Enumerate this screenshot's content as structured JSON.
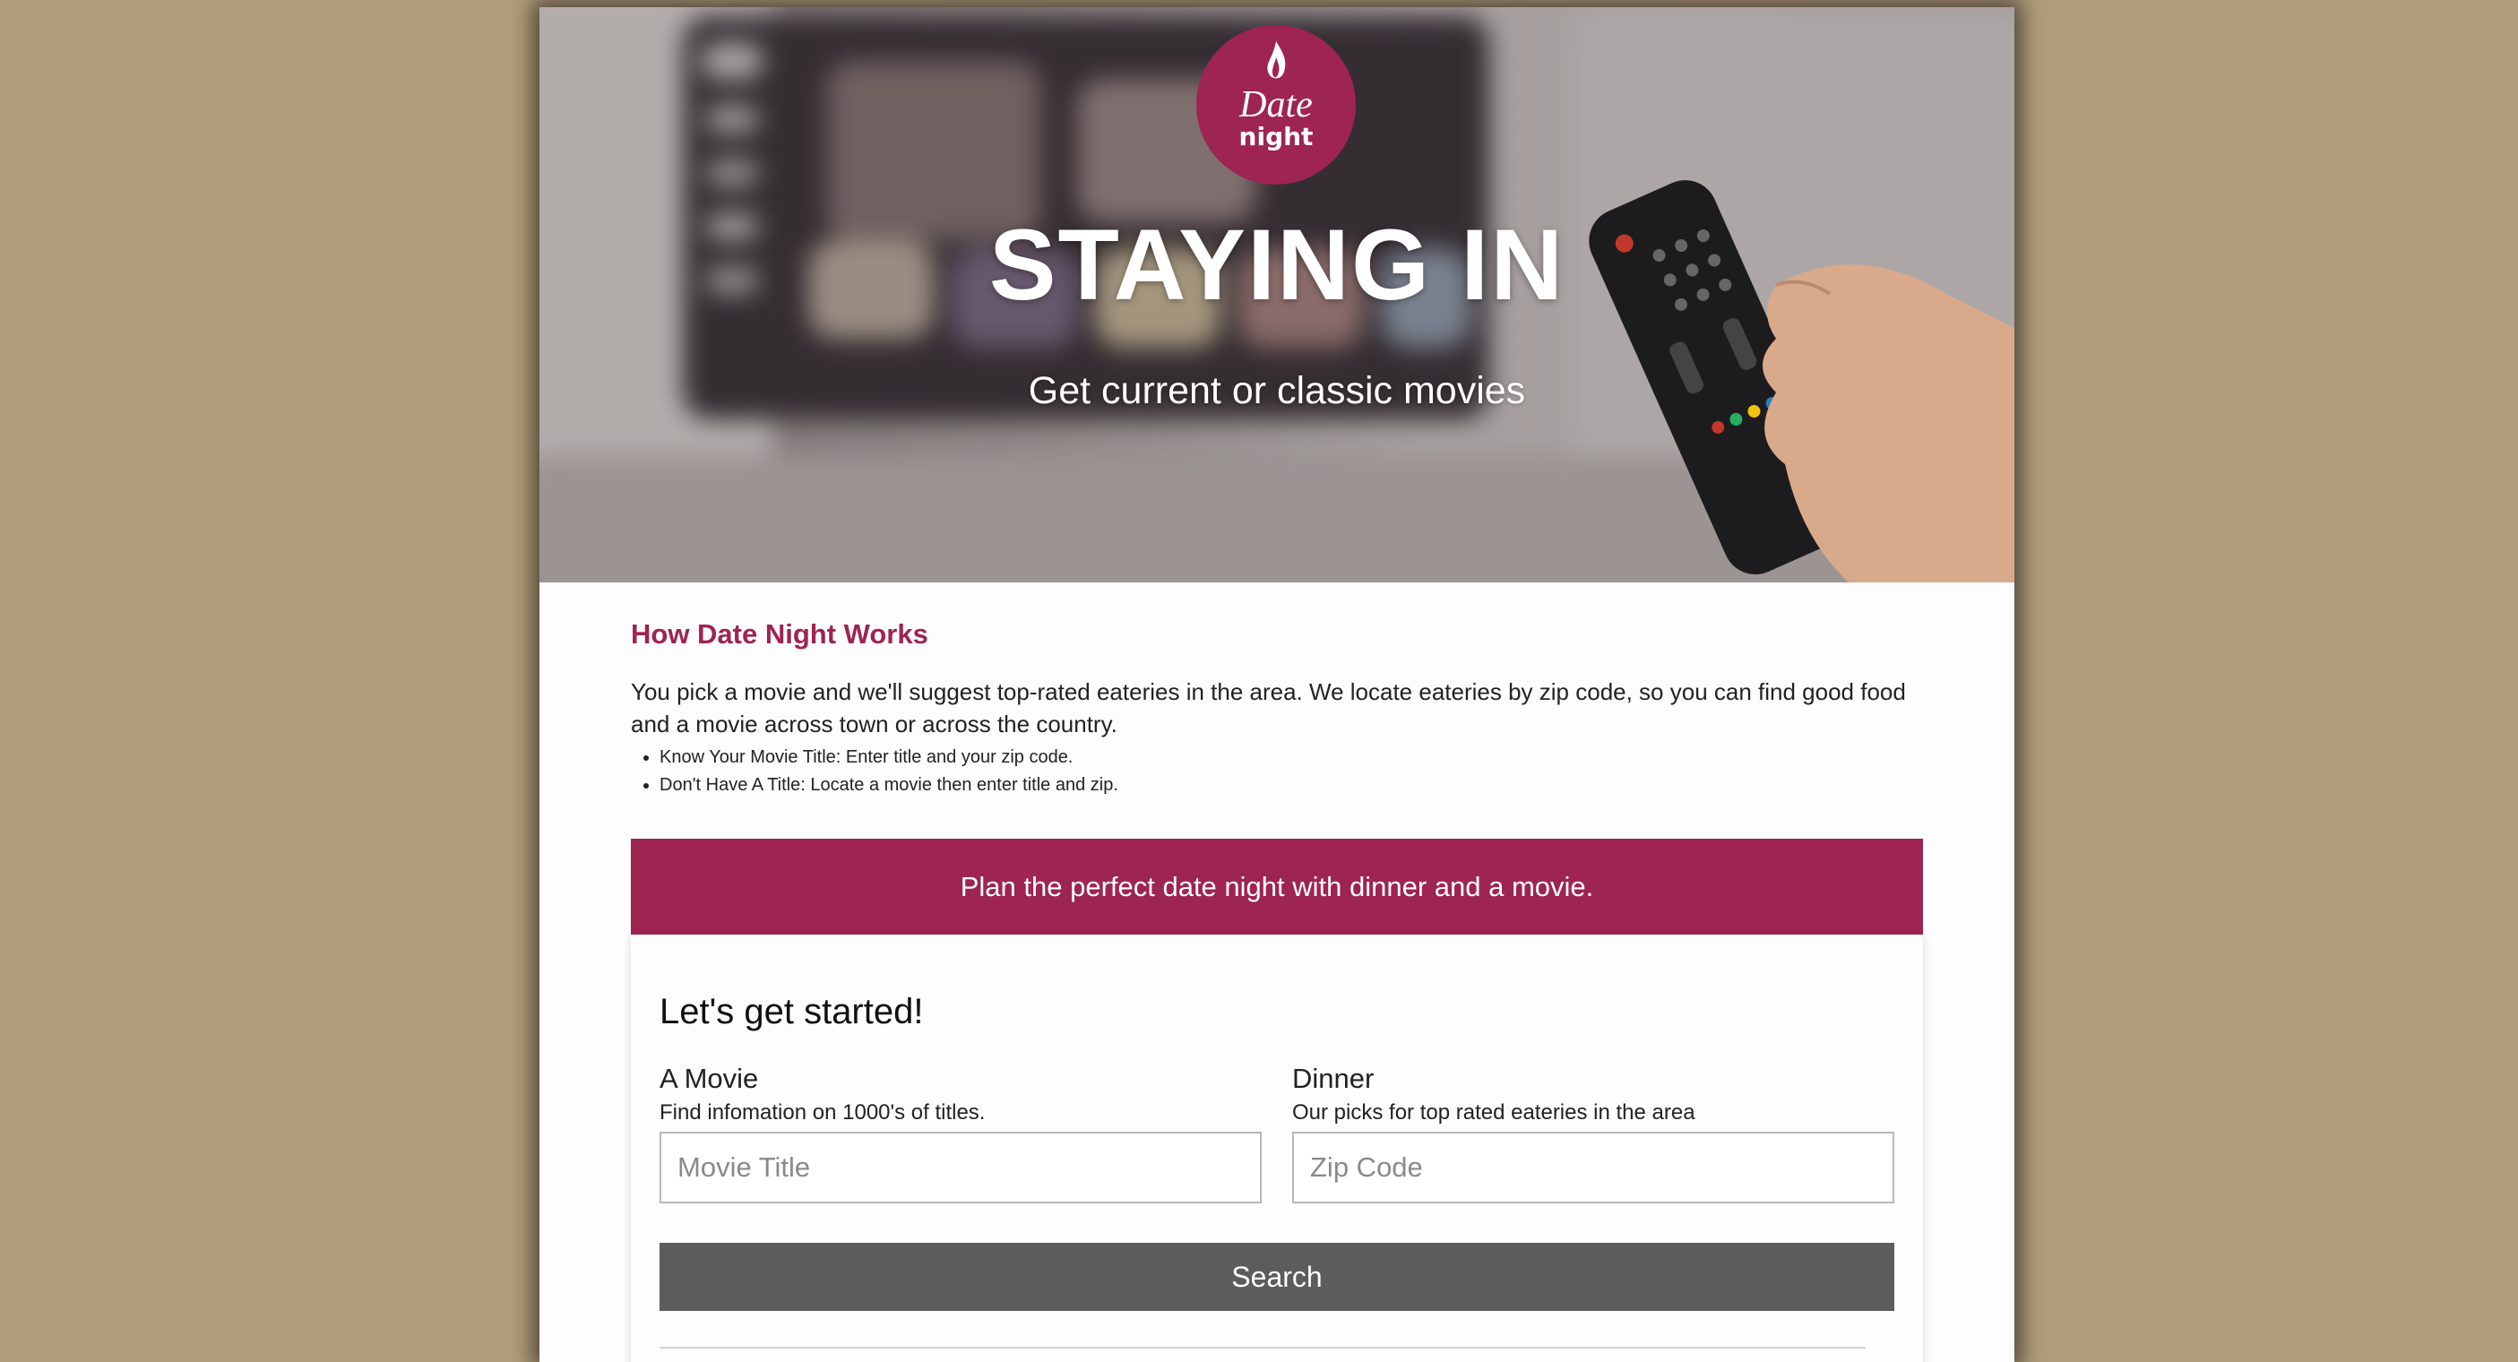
{
  "hero": {
    "logo_line1": "Date",
    "logo_line2": "night",
    "title": "STAYING IN",
    "subtitle": "Get current or classic movies"
  },
  "how_it_works": {
    "heading": "How Date Night Works",
    "description": "You pick a movie and we'll suggest top-rated eateries in the area. We locate eateries by zip code, so you can find good food and a movie across town or across the country.",
    "bullets": [
      "Know Your Movie Title: Enter title and your zip code.",
      "Don't Have A Title: Locate a movie then enter title and zip."
    ]
  },
  "banner": {
    "text": "Plan the perfect date night with dinner and a movie."
  },
  "form": {
    "title": "Let's get started!",
    "movie": {
      "label": "A Movie",
      "description": "Find infomation on 1000's of titles.",
      "placeholder": "Movie Title",
      "value": ""
    },
    "dinner": {
      "label": "Dinner",
      "description": "Our picks for top rated eateries in the area",
      "placeholder": "Zip Code",
      "value": ""
    },
    "search_label": "Search"
  },
  "colors": {
    "brand": "#9e2452",
    "background": "#b19c7b",
    "button": "#5c5c5c"
  }
}
